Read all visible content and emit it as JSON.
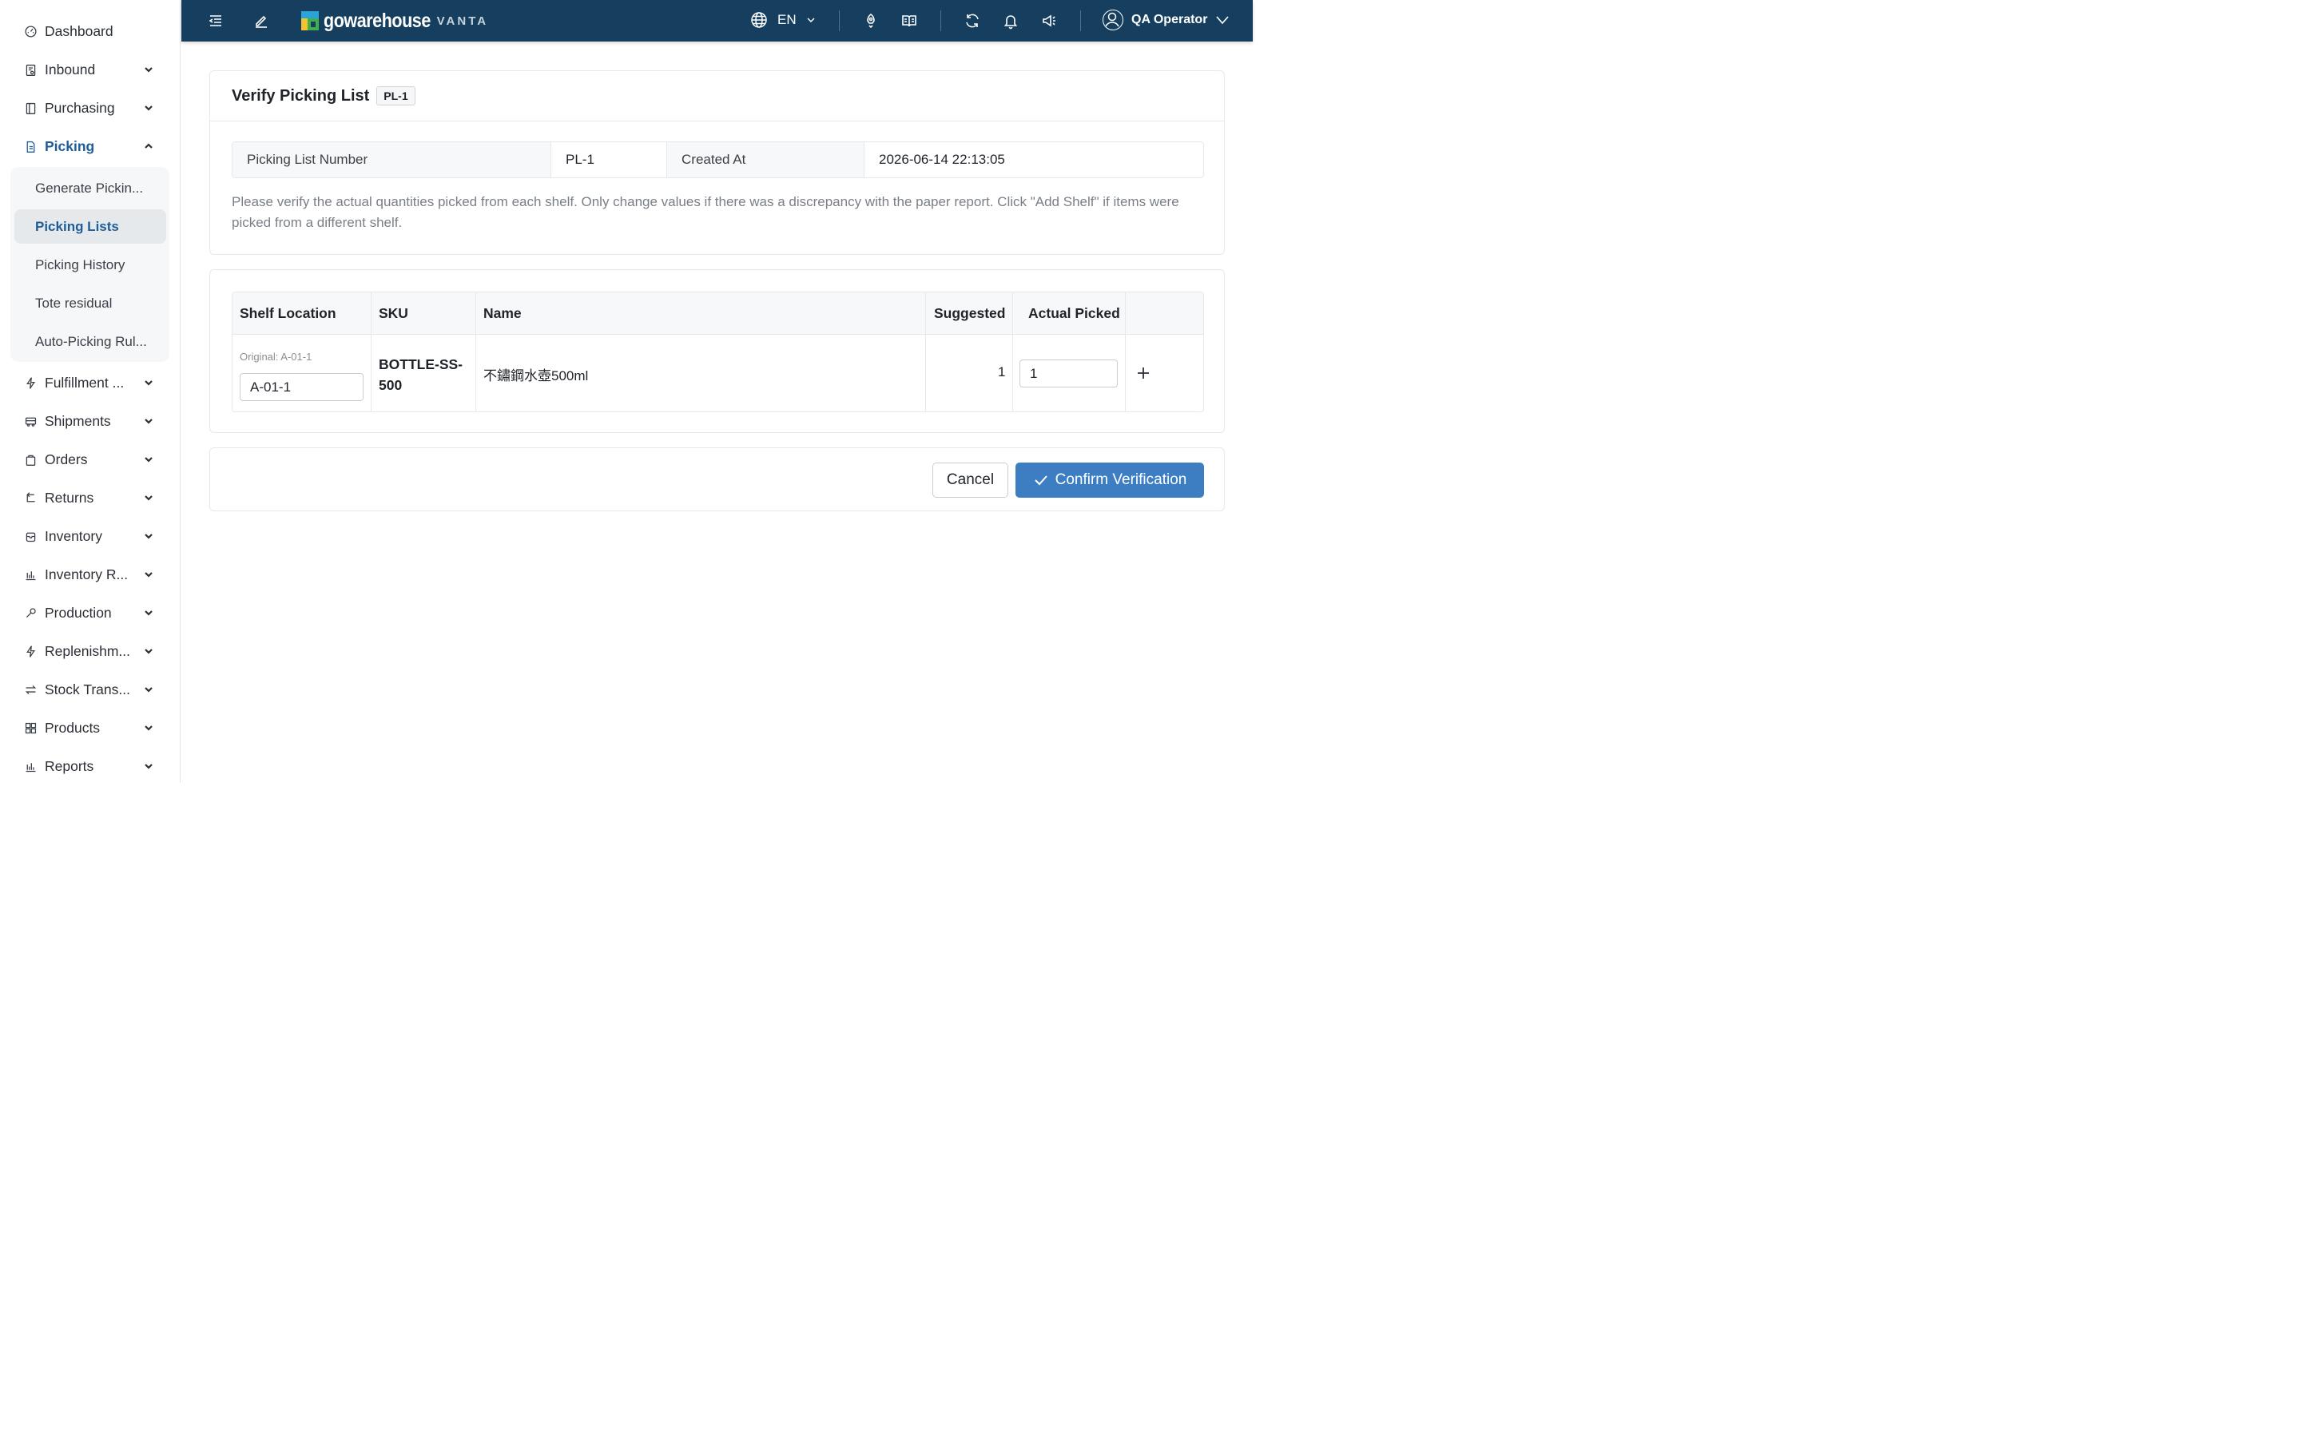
{
  "sidebar": {
    "items": [
      {
        "label": "Dashboard",
        "icon": "dashboard-icon"
      },
      {
        "label": "Inbound",
        "icon": "inbound-icon"
      },
      {
        "label": "Purchasing",
        "icon": "purchasing-icon"
      },
      {
        "label": "Picking",
        "icon": "picking-icon"
      },
      {
        "label": "Fulfillment ...",
        "icon": "lightning-icon"
      },
      {
        "label": "Shipments",
        "icon": "truck-icon"
      },
      {
        "label": "Orders",
        "icon": "bag-icon"
      },
      {
        "label": "Returns",
        "icon": "return-icon"
      },
      {
        "label": "Inventory",
        "icon": "box-icon"
      },
      {
        "label": "Inventory R...",
        "icon": "bar-chart-icon"
      },
      {
        "label": "Production",
        "icon": "wrench-icon"
      },
      {
        "label": "Replenishm...",
        "icon": "lightning-icon"
      },
      {
        "label": "Stock Trans...",
        "icon": "transfer-icon"
      },
      {
        "label": "Products",
        "icon": "grid-icon"
      },
      {
        "label": "Reports",
        "icon": "bar-chart-icon"
      }
    ],
    "picking_submenu": [
      {
        "label": "Generate Pickin..."
      },
      {
        "label": "Picking Lists"
      },
      {
        "label": "Picking History"
      },
      {
        "label": "Tote residual"
      },
      {
        "label": "Auto-Picking Rul..."
      }
    ]
  },
  "topbar": {
    "logo_text": "gowarehouse",
    "logo_sub": "VANTA",
    "language": "EN",
    "user_name": "QA Operator",
    "bg_color": "#163f5f"
  },
  "page": {
    "title": "Verify Picking List",
    "tag": "PL-1",
    "info": {
      "number_label": "Picking List Number",
      "number_value": "PL-1",
      "created_label": "Created At",
      "created_value": "2026-06-14 22:13:05"
    },
    "notice": "Please verify the actual quantities picked from each shelf. Only change values if there was a discrepancy with the paper report. Click \"Add Shelf\" if items were picked from a different shelf."
  },
  "table": {
    "headers": {
      "shelf": "Shelf Location",
      "sku": "SKU",
      "name": "Name",
      "suggested": "Suggested",
      "actual": "Actual Picked"
    },
    "rows": [
      {
        "original_note": "Original: A-01-1",
        "shelf_value": "A-01-1",
        "sku": "BOTTLE-SS-500",
        "sku_line1": "BOTTLE-SS-",
        "sku_line2": "500",
        "name": "不鏽鋼水壺500ml",
        "suggested": "1",
        "actual": "1"
      }
    ]
  },
  "actions": {
    "cancel": "Cancel",
    "confirm": "Confirm Verification",
    "accent_color": "#3d7ec2"
  }
}
